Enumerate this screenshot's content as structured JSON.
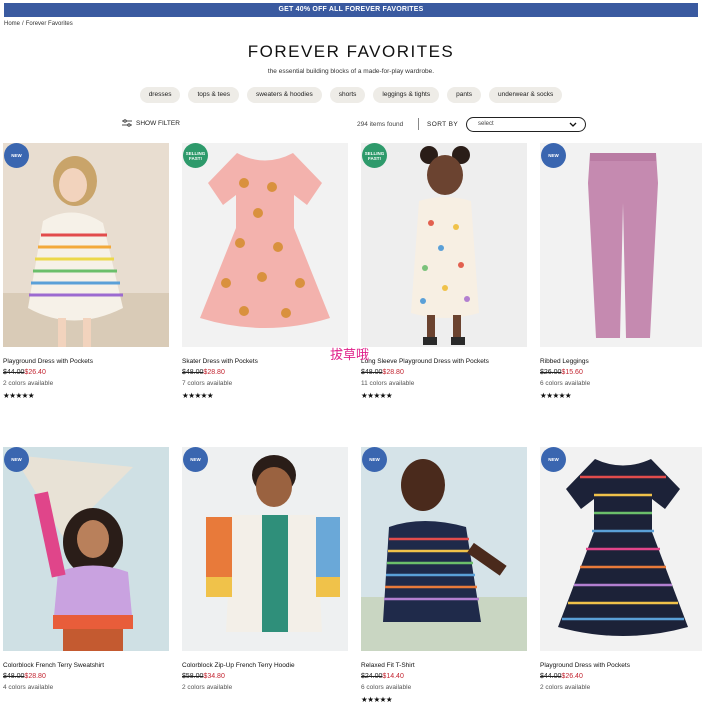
{
  "promo": "GET 40% OFF ALL FOREVER FAVORITES",
  "breadcrumb": {
    "home": "Home",
    "sep": "/",
    "current": "Forever Favorites"
  },
  "title": "FOREVER FAVORITES",
  "subtitle": "the essential building blocks of a made-for-play wardrobe.",
  "categories": [
    "dresses",
    "tops & tees",
    "sweaters & hoodies",
    "shorts",
    "leggings & tights",
    "pants",
    "underwear & socks"
  ],
  "toolbar": {
    "show_filter": "SHOW FILTER",
    "items_found": "294 items found",
    "sort_by": "SORT BY",
    "select_value": "select"
  },
  "overlay_text": "拔草哦",
  "products": [
    {
      "badge": "NEW",
      "name": "Playground Dress with Pockets",
      "old_price": "$44.00",
      "sale_price": "$26.40",
      "colors": "2 colors available",
      "stars": "★★★★★",
      "rating": 5
    },
    {
      "badge": "SELLING FAST!",
      "name": "Skater Dress with Pockets",
      "old_price": "$48.00",
      "sale_price": "$28.80",
      "colors": "7 colors available",
      "stars": "★★★★★",
      "rating": 5
    },
    {
      "badge": "SELLING FAST!",
      "name": "Long Sleeve Playground Dress with Pockets",
      "old_price": "$48.00",
      "sale_price": "$28.80",
      "colors": "11 colors available",
      "stars": "★★★★★",
      "rating": 5
    },
    {
      "badge": "NEW",
      "name": "Ribbed Leggings",
      "old_price": "$26.00",
      "sale_price": "$15.60",
      "colors": "6 colors available",
      "stars": "★★★★★",
      "rating": 5
    },
    {
      "badge": "NEW",
      "name": "Colorblock French Terry Sweatshirt",
      "old_price": "$48.00",
      "sale_price": "$28.80",
      "colors": "4 colors available",
      "stars": "",
      "rating": null
    },
    {
      "badge": "NEW",
      "name": "Colorblock Zip-Up French Terry Hoodie",
      "old_price": "$58.00",
      "sale_price": "$34.80",
      "colors": "2 colors available",
      "stars": "",
      "rating": null
    },
    {
      "badge": "NEW",
      "name": "Relaxed Fit T-Shirt",
      "old_price": "$24.00",
      "sale_price": "$14.40",
      "colors": "6 colors available",
      "stars": "★★★★★",
      "rating": 5
    },
    {
      "badge": "NEW",
      "name": "Playground Dress with Pockets",
      "old_price": "$44.00",
      "sale_price": "$26.40",
      "colors": "2 colors available",
      "stars": "",
      "rating": null
    }
  ],
  "colors": {
    "promo_bg": "#3a5aa0",
    "sale": "#c2232f",
    "badge_new": "#3a66b0",
    "badge_selling": "#2e9a6b",
    "chip_bg": "#eeece7"
  }
}
